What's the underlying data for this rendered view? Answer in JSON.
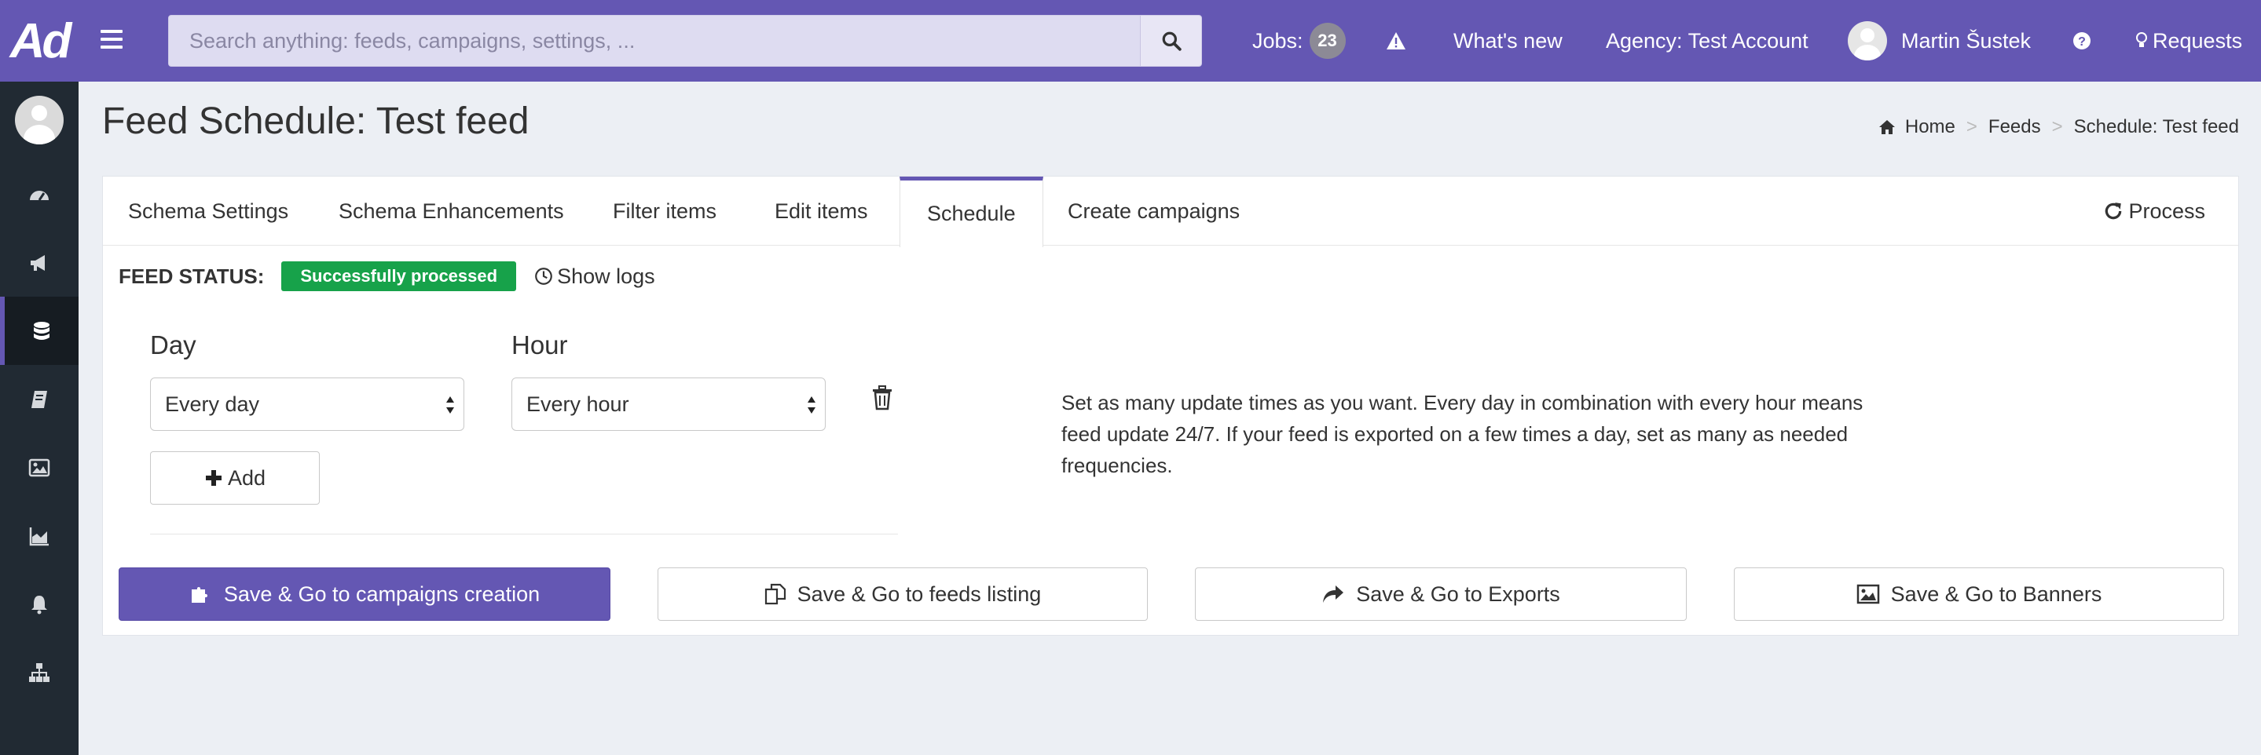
{
  "topbar": {
    "logo": "Ad",
    "search_placeholder": "Search anything: feeds, campaigns, settings, ...",
    "jobs_label": "Jobs:",
    "jobs_count": "23",
    "whats_new": "What's new",
    "agency": "Agency: Test Account",
    "user_name": "Martin Šustek",
    "requests": "Requests"
  },
  "page": {
    "title": "Feed Schedule: Test feed"
  },
  "breadcrumb": {
    "home": "Home",
    "feeds": "Feeds",
    "current": "Schedule: Test feed",
    "separator": ">"
  },
  "tabs": [
    {
      "label": "Schema Settings"
    },
    {
      "label": "Schema Enhancements"
    },
    {
      "label": "Filter items"
    },
    {
      "label": "Edit items"
    },
    {
      "label": "Schedule",
      "active": true
    },
    {
      "label": "Create campaigns"
    }
  ],
  "process_label": "Process",
  "feed_status": {
    "label": "FEED STATUS:",
    "badge": "Successfully processed",
    "badge_color": "#17a24a",
    "show_logs": "Show logs"
  },
  "schedule": {
    "day_label": "Day",
    "hour_label": "Hour",
    "day_value": "Every day",
    "hour_value": "Every hour",
    "add_label": "Add",
    "help_text": "Set as many update times as you want. Every day in combination with every hour means feed update 24/7. If your feed is exported on a few times a day, set as many as needed frequencies."
  },
  "actions": {
    "campaigns": "Save & Go to campaigns creation",
    "feeds": "Save & Go to feeds listing",
    "exports": "Save & Go to Exports",
    "banners": "Save & Go to Banners"
  },
  "colors": {
    "accent": "#6457b3",
    "sidebar": "#212a33",
    "success": "#17a24a"
  },
  "sidebar_icons": [
    "dashboard-icon",
    "megaphone-icon",
    "database-icon",
    "book-icon",
    "image-icon",
    "area-chart-icon",
    "bell-icon",
    "sitemap-icon"
  ]
}
